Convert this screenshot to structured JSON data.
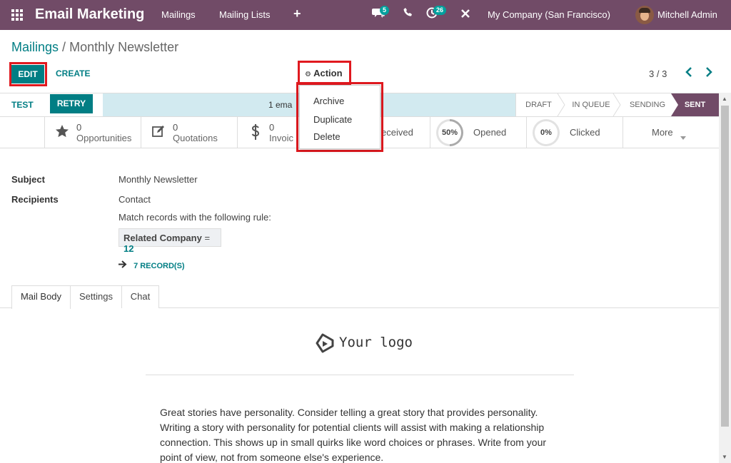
{
  "navbar": {
    "app_title": "Email Marketing",
    "menu": [
      "Mailings",
      "Mailing Lists"
    ],
    "add_symbol": "+",
    "messages_badge": "5",
    "activities_badge": "26",
    "company": "My Company (San Francisco)",
    "user": "Mitchell Admin"
  },
  "breadcrumb": {
    "parent": "Mailings",
    "separator": "/",
    "current": "Monthly Newsletter"
  },
  "toolbar": {
    "edit": "EDIT",
    "create": "CREATE",
    "action": "Action",
    "pager": "3 / 3"
  },
  "action_menu": [
    "Archive",
    "Duplicate",
    "Delete"
  ],
  "statusbar": {
    "test": "TEST",
    "retry": "RETRY",
    "info": "1 ema",
    "stages": [
      "DRAFT",
      "IN QUEUE",
      "SENDING",
      "SENT"
    ],
    "current_stage": "SENT"
  },
  "smart_buttons": [
    {
      "value": "0",
      "label": "Opportunities",
      "icon": "star-icon"
    },
    {
      "value": "0",
      "label": "Quotations",
      "icon": "edit-icon"
    },
    {
      "value": "0",
      "label": "Invoic",
      "icon": "dollar-icon"
    },
    {
      "label": "eceived"
    },
    {
      "percent": "50%",
      "label": "Opened",
      "fraction": 0.5
    },
    {
      "percent": "0%",
      "label": "Clicked",
      "fraction": 0
    },
    {
      "label": "More"
    }
  ],
  "fields": {
    "subject_label": "Subject",
    "subject_value": "Monthly Newsletter",
    "recipients_label": "Recipients",
    "recipients_value": "Contact",
    "rule_text": "Match records with the following rule:",
    "rule_field": "Related Company",
    "rule_op": "=",
    "rule_value": "12",
    "records": "7 RECORD(S)"
  },
  "tabs": [
    "Mail Body",
    "Settings",
    "Chat"
  ],
  "mail_body": {
    "logo_text": "Your logo",
    "paragraph": "Great stories have personality. Consider telling a great story that provides personality. Writing a story with personality for potential clients will assist with making a relationship connection. This shows up in small quirks like word choices or phrases. Write from your point of view, not from someone else's experience."
  },
  "colors": {
    "brand": "#714b67",
    "accent": "#017e84",
    "highlight": "#e0191f",
    "info_band": "#d2eaf0"
  }
}
